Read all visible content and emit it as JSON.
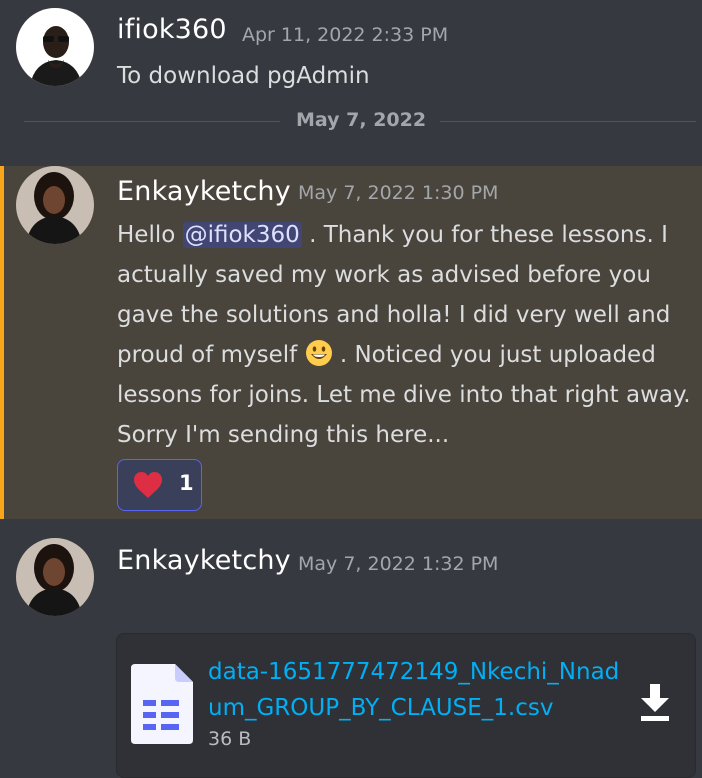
{
  "messages": [
    {
      "author": "ifiok360",
      "timestamp": "Apr 11, 2022 2:33 PM",
      "text": "To download pgAdmin"
    },
    {
      "author": "Enkayketchy",
      "timestamp": "May 7, 2022 1:30 PM",
      "lines": {
        "l1_pre": "Hello ",
        "mention": "@ifiok360",
        "l1_post": " . Thank you for these lessons. I",
        "l2": "actually saved my work as advised before you",
        "l3": "gave the solutions and holla! I did very well and",
        "l4_pre": "proud of myself ",
        "l4_post": " . Noticed you just uploaded",
        "l5": "lessons for joins. Let me dive into that right away.",
        "l6": "Sorry I'm sending this here..."
      },
      "reaction": {
        "emoji": "heart",
        "count": "1"
      },
      "highlighted": true,
      "highlight_color": "#faa61a"
    },
    {
      "author": "Enkayketchy",
      "timestamp": "May 7, 2022 1:32 PM",
      "attachment": {
        "name_line1": "data-1651777472149_Nkechi_Nnad",
        "name_line2": "um_GROUP_BY_CLAUSE_1.csv",
        "size": "36 B",
        "icon": "spreadsheet-file-icon"
      }
    }
  ],
  "date_divider": "May 7, 2022",
  "colors": {
    "background": "#36393f",
    "link": "#00aff4",
    "mention_bg": "#414675",
    "reaction_border": "#5865f2"
  }
}
